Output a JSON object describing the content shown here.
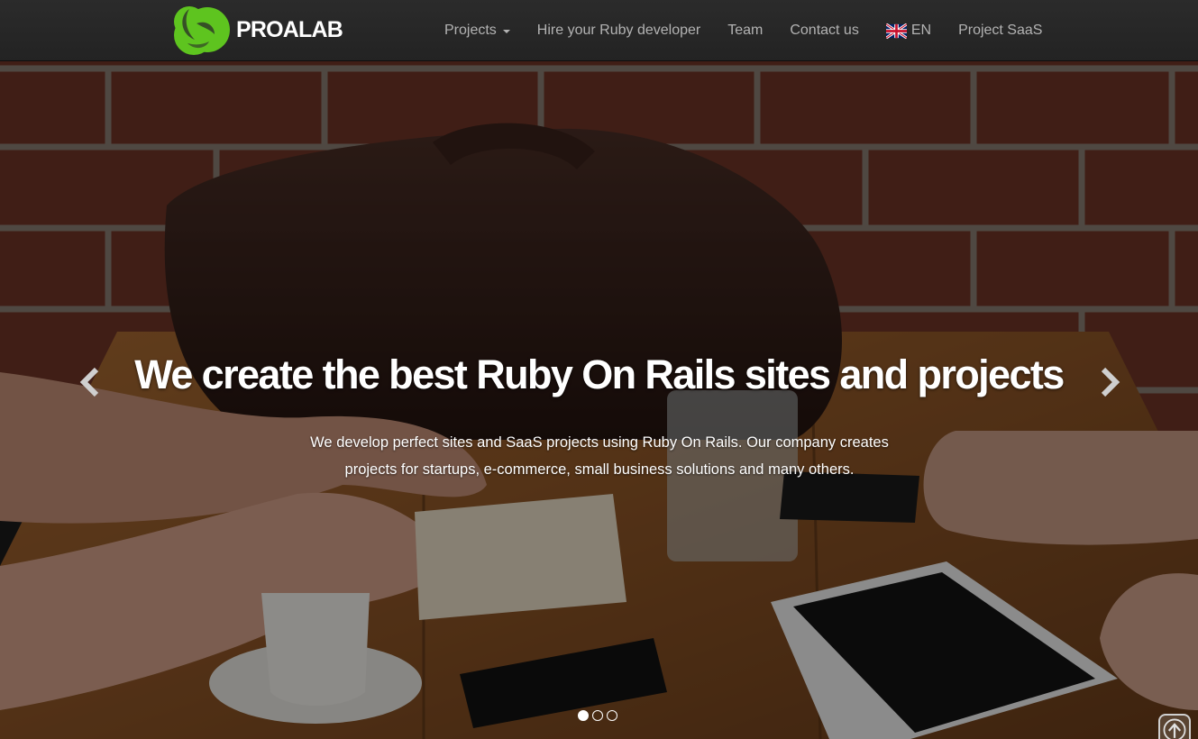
{
  "brand": {
    "name": "PROALAB",
    "logo_icon": "proalab-logo-icon"
  },
  "nav": {
    "items": [
      {
        "label": "Projects",
        "has_dropdown": true
      },
      {
        "label": "Hire your Ruby developer"
      },
      {
        "label": "Team"
      },
      {
        "label": "Contact us"
      },
      {
        "label": "EN",
        "icon": "uk-flag-icon"
      },
      {
        "label": "Project SaaS"
      }
    ]
  },
  "hero": {
    "title": "We create the best Ruby On Rails sites and projects",
    "description": "We develop perfect sites and SaaS projects using Ruby On Rails. Our company creates projects for startups, e-commerce, small business solutions and many others.",
    "prev_icon": "chevron-left-icon",
    "next_icon": "chevron-right-icon",
    "slides_count": 3,
    "active_slide": 1
  },
  "colors": {
    "accent_green": "#5ec41f",
    "navbar": "#262626"
  }
}
